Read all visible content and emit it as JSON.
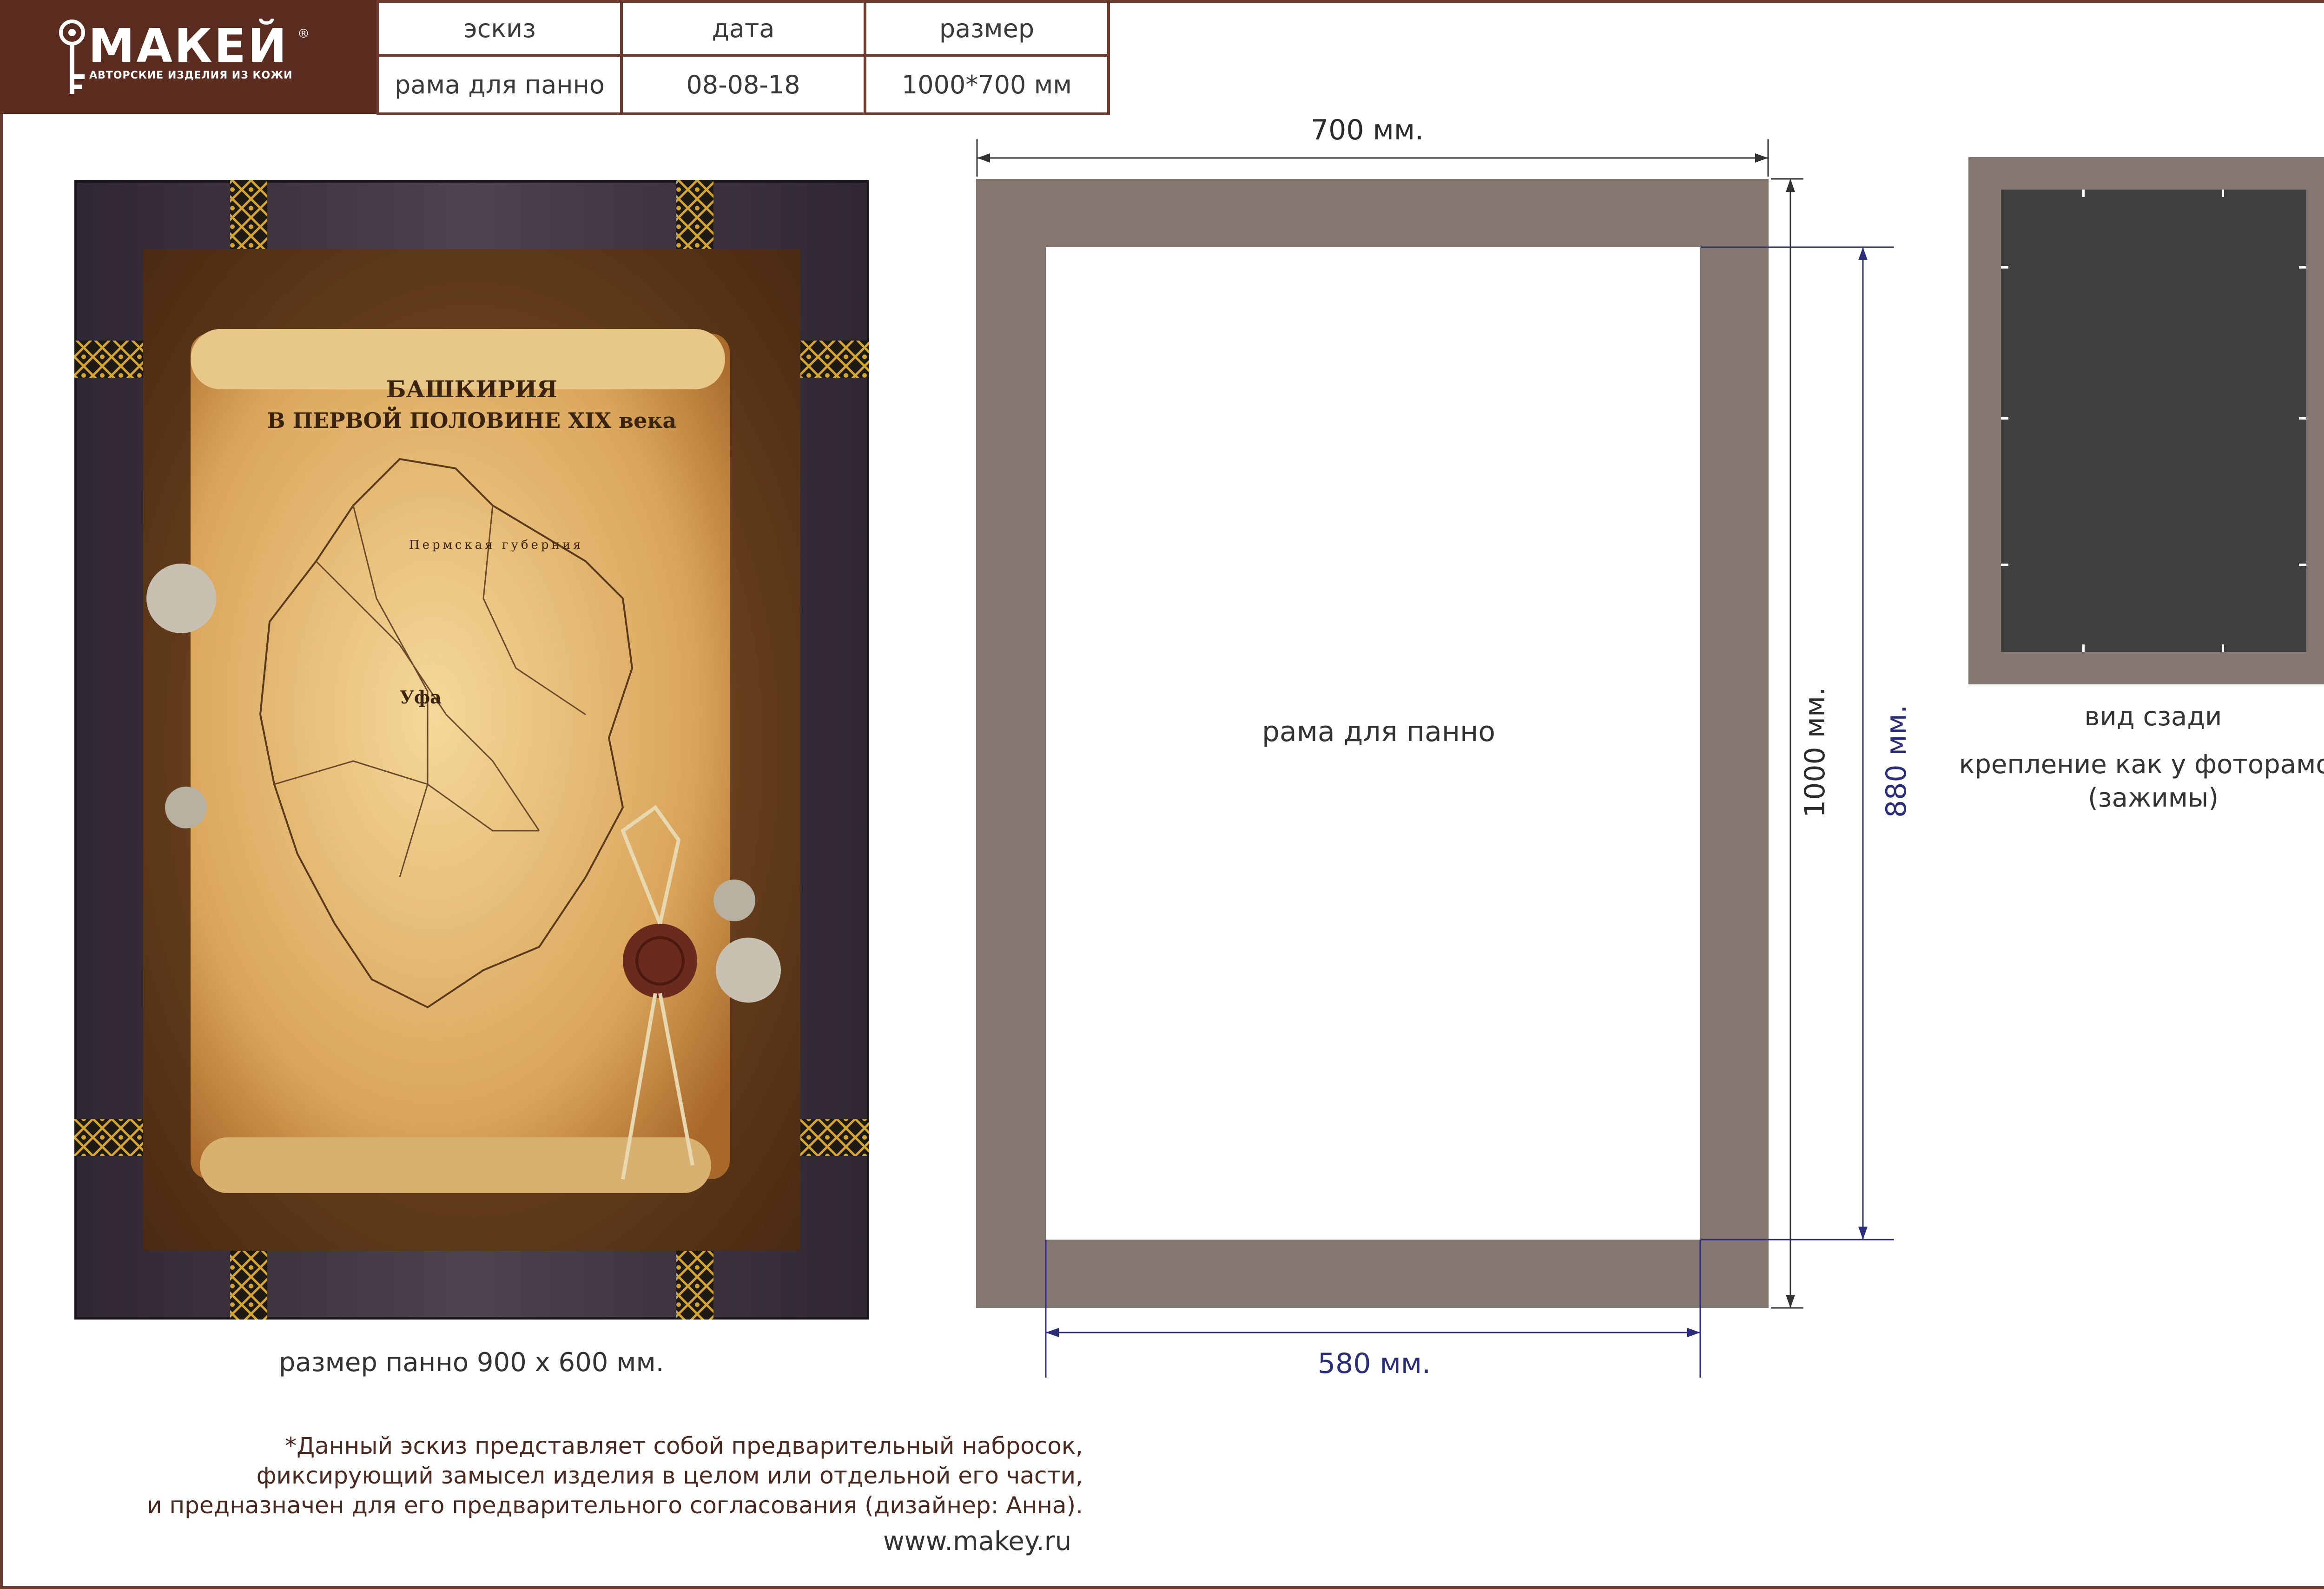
{
  "brand": {
    "name": "МАКЕЙ",
    "reg_mark": "®",
    "tagline": "АВТОРСКИЕ ИЗДЕЛИЯ ИЗ КОЖИ"
  },
  "info_table": {
    "headers": [
      "эскиз",
      "дата",
      "размер"
    ],
    "values": [
      "рама для панно",
      "08-08-18",
      "1000*700 мм"
    ]
  },
  "panel": {
    "map_title_line1": "БАШКИРИЯ",
    "map_title_line2": "В ПЕРВОЙ ПОЛОВИНЕ XIX века",
    "map_region_label": "Пермская губерния",
    "map_city_label": "Уфа",
    "caption": "размер панно 900 х 600 мм."
  },
  "frame_diagram": {
    "label": "рама для панно",
    "dim_width": "700 мм.",
    "dim_height": "1000 мм.",
    "dim_inner_width": "580 мм.",
    "dim_inner_height": "880 мм."
  },
  "back_view": {
    "label": "вид сзади",
    "note_line1": "крепление как у фоторамок",
    "note_line2": "(зажимы)"
  },
  "footer": {
    "disclaimer_line1": "*Данный эскиз представляет собой  предварительный набросок,",
    "disclaimer_line2": "фиксирующий замысел изделия в целом или отдельной его части,",
    "disclaimer_line3": "и предназначен для его предварительного согласования (дизайнер: Анна).",
    "website": "www.makey.ru"
  },
  "colors": {
    "brand_brown": "#5a2c1f",
    "border_brown": "#6e3b2e",
    "frame_taupe": "#857871",
    "back_dark": "#3f3f3f",
    "dimension_blue": "#2a2e7a"
  }
}
